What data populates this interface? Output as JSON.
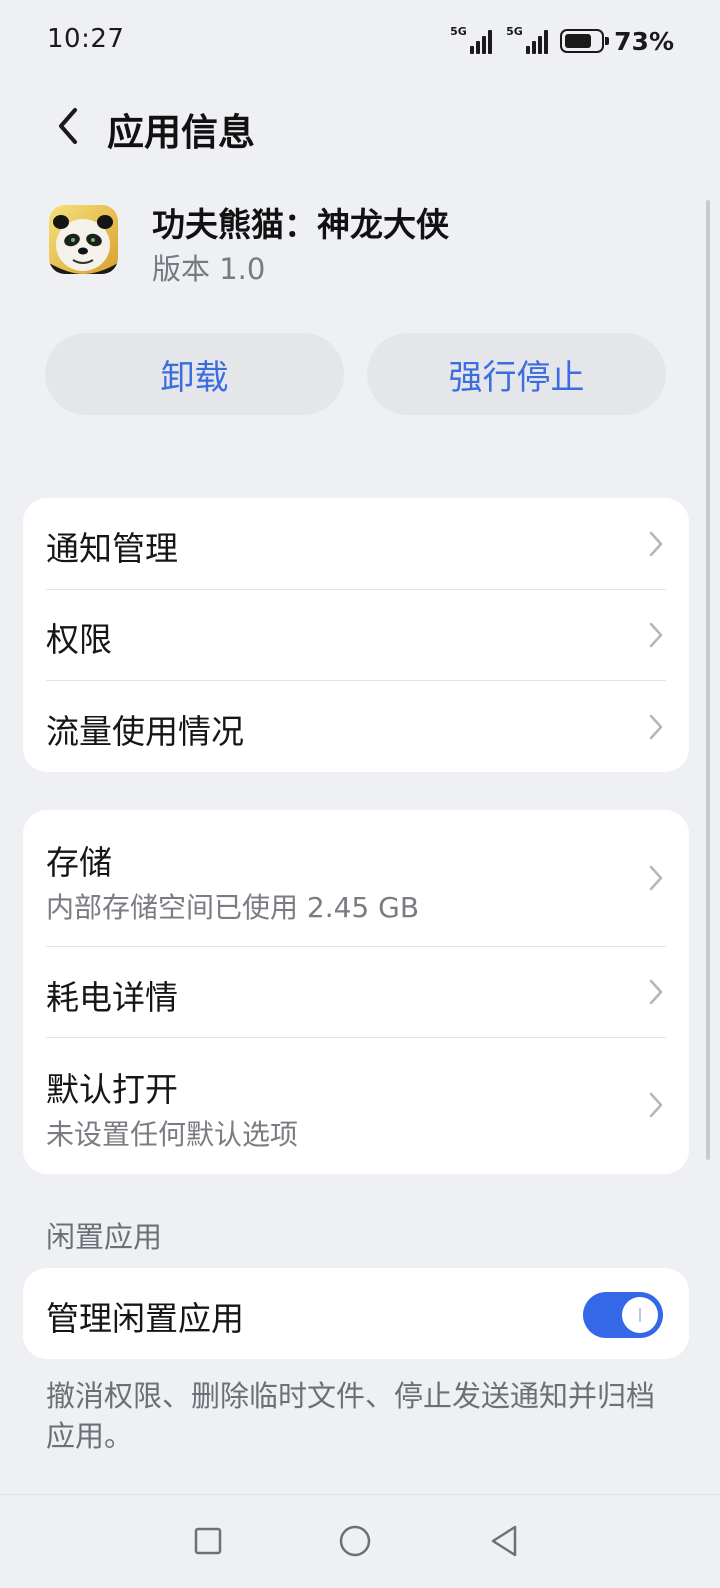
{
  "status_bar": {
    "time": "10:27",
    "signal_1_label": "5G",
    "signal_2_label": "5G",
    "battery_percent": "73%",
    "battery_level": 0.73
  },
  "header": {
    "title": "应用信息",
    "back_icon": "chevron-left-icon"
  },
  "app": {
    "name": "功夫熊猫：神龙大侠",
    "version": "版本 1.0",
    "icon": "panda-app-icon"
  },
  "actions": {
    "uninstall": "卸载",
    "force_stop": "强行停止",
    "accent_color": "#3b6ce0"
  },
  "group1": {
    "items": [
      {
        "label": "通知管理"
      },
      {
        "label": "权限"
      },
      {
        "label": "流量使用情况"
      }
    ]
  },
  "group2": {
    "storage": {
      "label": "存储",
      "sub": "内部存储空间已使用 2.45 GB"
    },
    "battery": {
      "label": "耗电详情"
    },
    "default_open": {
      "label": "默认打开",
      "sub": "未设置任何默认选项"
    }
  },
  "idle": {
    "section_label": "闲置应用",
    "manage_label": "管理闲置应用",
    "toggle_on": true,
    "toggle_color": "#3468e8",
    "description": "撤消权限、删除临时文件、停止发送通知并归档应用。"
  },
  "nav_bar": {
    "recent_icon": "square-icon",
    "home_icon": "circle-icon",
    "back_icon": "triangle-back-icon"
  }
}
